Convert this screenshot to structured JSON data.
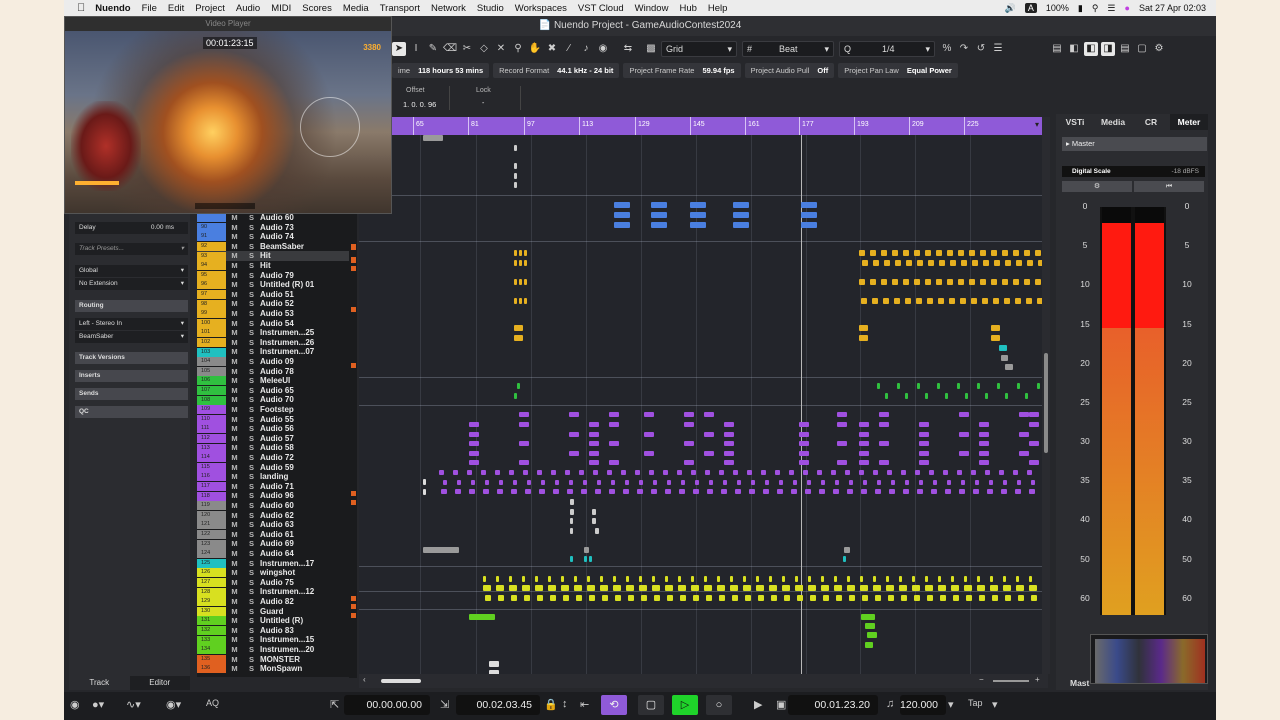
{
  "menubar": {
    "app": "Nuendo",
    "items": [
      "File",
      "Edit",
      "Project",
      "Audio",
      "MIDI",
      "Scores",
      "Media",
      "Transport",
      "Network",
      "Studio",
      "Workspaces",
      "VST Cloud",
      "Window",
      "Hub",
      "Help"
    ],
    "battery": "100%",
    "datetime": "Sat 27 Apr  02:03",
    "input_letter": "A"
  },
  "window": {
    "title": "Nuendo Project - GameAudioContest2024"
  },
  "video_player": {
    "title": "Video Player",
    "timecode": "00:01:23:15",
    "score": "3380"
  },
  "toolbar": {
    "grid_label": "Grid",
    "beat_label": "Beat",
    "quantize_value": "1/4"
  },
  "status": [
    {
      "label": "ime",
      "value": "118 hours 53 mins"
    },
    {
      "label": "Record Format",
      "value": "44.1 kHz - 24 bit"
    },
    {
      "label": "Project Frame Rate",
      "value": "59.94 fps"
    },
    {
      "label": "Project Audio Pull",
      "value": "Off"
    },
    {
      "label": "Project Pan Law",
      "value": "Equal Power"
    }
  ],
  "info_line": {
    "offset_label": "Offset",
    "offset_value": "1. 0. 0. 96",
    "lock_label": "Lock",
    "lock_value": "-"
  },
  "inspector": {
    "delay_label": "Delay",
    "delay_value": "0.00 ms",
    "track_presets": "Track Presets...",
    "global": "Global",
    "no_extension": "No Extension",
    "routing": "Routing",
    "input": "Left - Stereo In",
    "output": "BeamSaber",
    "track_versions": "Track Versions",
    "inserts": "Inserts",
    "sends": "Sends",
    "qc": "QC",
    "tab_track": "Track",
    "tab_editor": "Editor"
  },
  "tracks": [
    {
      "num": "",
      "name": "Audio 60",
      "color": "#4a7fe0",
      "sel": false,
      "mute": false
    },
    {
      "num": "90",
      "name": "Audio 73",
      "color": "#4a7fe0",
      "sel": false,
      "mute": false
    },
    {
      "num": "91",
      "name": "Audio 74",
      "color": "#4a7fe0",
      "sel": false,
      "mute": false
    },
    {
      "num": "92",
      "name": "BeamSaber",
      "color": "#e6b020",
      "sel": false,
      "mute": false
    },
    {
      "num": "93",
      "name": "Hit",
      "color": "#e6b020",
      "sel": true,
      "mute": false
    },
    {
      "num": "94",
      "name": "Hit",
      "color": "#e6b020",
      "sel": false,
      "mute": false
    },
    {
      "num": "95",
      "name": "Audio 79",
      "color": "#e6b020",
      "sel": false,
      "mute": false
    },
    {
      "num": "96",
      "name": "Untitled (R) 01",
      "color": "#e6b020",
      "sel": false,
      "mute": false
    },
    {
      "num": "97",
      "name": "Audio 51",
      "color": "#e6b020",
      "sel": false,
      "mute": false
    },
    {
      "num": "98",
      "name": "Audio 52",
      "color": "#e6b020",
      "sel": false,
      "mute": false
    },
    {
      "num": "99",
      "name": "Audio 53",
      "color": "#e6b020",
      "sel": false,
      "mute": false
    },
    {
      "num": "100",
      "name": "Audio 54",
      "color": "#e6b020",
      "sel": false,
      "mute": false
    },
    {
      "num": "101",
      "name": "Instrumen...25",
      "color": "#e6b020",
      "sel": false,
      "mute": false
    },
    {
      "num": "102",
      "name": "Instrumen...26",
      "color": "#e6b020",
      "sel": false,
      "mute": false
    },
    {
      "num": "103",
      "name": "Instrumen...07",
      "color": "#20c0c0",
      "sel": false,
      "mute": false
    },
    {
      "num": "104",
      "name": "Audio 09",
      "color": "#8a8a8a",
      "sel": false,
      "mute": false
    },
    {
      "num": "105",
      "name": "Audio 78",
      "color": "#8a8a8a",
      "sel": false,
      "mute": false
    },
    {
      "num": "106",
      "name": "MeleeUI",
      "color": "#30c040",
      "sel": false,
      "mute": false
    },
    {
      "num": "107",
      "name": "Audio 65",
      "color": "#30c040",
      "sel": false,
      "mute": false
    },
    {
      "num": "108",
      "name": "Audio 70",
      "color": "#30c040",
      "sel": false,
      "mute": false
    },
    {
      "num": "109",
      "name": "Footstep",
      "color": "#a050e0",
      "sel": false,
      "mute": false
    },
    {
      "num": "110",
      "name": "Audio 55",
      "color": "#a050e0",
      "sel": false,
      "mute": false
    },
    {
      "num": "111",
      "name": "Audio 56",
      "color": "#a050e0",
      "sel": false,
      "mute": false
    },
    {
      "num": "112",
      "name": "Audio 57",
      "color": "#a050e0",
      "sel": false,
      "mute": false
    },
    {
      "num": "113",
      "name": "Audio 58",
      "color": "#a050e0",
      "sel": false,
      "mute": false
    },
    {
      "num": "114",
      "name": "Audio 72",
      "color": "#a050e0",
      "sel": false,
      "mute": false
    },
    {
      "num": "115",
      "name": "Audio 59",
      "color": "#a050e0",
      "sel": false,
      "mute": false
    },
    {
      "num": "116",
      "name": "landing",
      "color": "#a050e0",
      "sel": false,
      "mute": false
    },
    {
      "num": "117",
      "name": "Audio 71",
      "color": "#a050e0",
      "sel": false,
      "mute": false
    },
    {
      "num": "118",
      "name": "Audio 96",
      "color": "#a050e0",
      "sel": false,
      "mute": false
    },
    {
      "num": "119",
      "name": "Audio 60",
      "color": "#8a8a8a",
      "sel": false,
      "mute": false
    },
    {
      "num": "120",
      "name": "Audio 62",
      "color": "#8a8a8a",
      "sel": false,
      "mute": false
    },
    {
      "num": "121",
      "name": "Audio 63",
      "color": "#8a8a8a",
      "sel": false,
      "mute": false
    },
    {
      "num": "122",
      "name": "Audio 61",
      "color": "#8a8a8a",
      "sel": false,
      "mute": false
    },
    {
      "num": "123",
      "name": "Audio 69",
      "color": "#8a8a8a",
      "sel": false,
      "mute": false
    },
    {
      "num": "124",
      "name": "Audio 64",
      "color": "#8a8a8a",
      "sel": false,
      "mute": false
    },
    {
      "num": "125",
      "name": "Instrumen...17",
      "color": "#20c0c0",
      "sel": false,
      "mute": false
    },
    {
      "num": "126",
      "name": "wingshot",
      "color": "#d8e020",
      "sel": false,
      "mute": false
    },
    {
      "num": "127",
      "name": "Audio 75",
      "color": "#d8e020",
      "sel": false,
      "mute": false
    },
    {
      "num": "128",
      "name": "Instrumen...12",
      "color": "#d8e020",
      "sel": false,
      "mute": false
    },
    {
      "num": "129",
      "name": "Audio 82",
      "color": "#d8e020",
      "sel": false,
      "mute": false
    },
    {
      "num": "130",
      "name": "Guard",
      "color": "#d8e020",
      "sel": false,
      "mute": false
    },
    {
      "num": "131",
      "name": "Untitled (R)",
      "color": "#60d020",
      "sel": false,
      "mute": false
    },
    {
      "num": "132",
      "name": "Audio 83",
      "color": "#60d020",
      "sel": false,
      "mute": false
    },
    {
      "num": "133",
      "name": "Instrumen...15",
      "color": "#60d020",
      "sel": false,
      "mute": false
    },
    {
      "num": "134",
      "name": "Instrumen...20",
      "color": "#60d020",
      "sel": false,
      "mute": false
    },
    {
      "num": "135",
      "name": "MONSTER",
      "color": "#e06020",
      "sel": false,
      "mute": false
    },
    {
      "num": "136",
      "name": "MonSpawn",
      "color": "#e06020",
      "sel": false,
      "mute": false
    }
  ],
  "ruler": {
    "labels": [
      "49",
      "65",
      "81",
      "97",
      "113",
      "129",
      "145",
      "161",
      "177",
      "193",
      "209",
      "225"
    ]
  },
  "right_zone": {
    "tabs": [
      "VSTi",
      "Media",
      "CR",
      "Meter"
    ],
    "active_tab": "Meter",
    "master": "Master",
    "digital_scale_label": "Digital Scale",
    "digital_scale_value": "-18 dBFS",
    "scale": [
      "0",
      "5",
      "10",
      "15",
      "20",
      "25",
      "30",
      "35",
      "40",
      "50",
      "60"
    ],
    "peak_db": 2,
    "hot_db": 15.5,
    "colors": {
      "hot": "#ff1a10",
      "warm": "#e8602a",
      "low": "#e0a020"
    },
    "bottom_tab": "Mast"
  },
  "transport": {
    "left_locator": "00.00.00.00",
    "right_locator": "00.02.03.45",
    "position": "00.01.23.20",
    "tempo": "120.000",
    "tap": "Tap",
    "aq": "AQ"
  },
  "colors": {
    "accent_ruler": "#8f5ad8",
    "play_active": "#1fd32a",
    "cycle_active": "#8f5ad8"
  }
}
